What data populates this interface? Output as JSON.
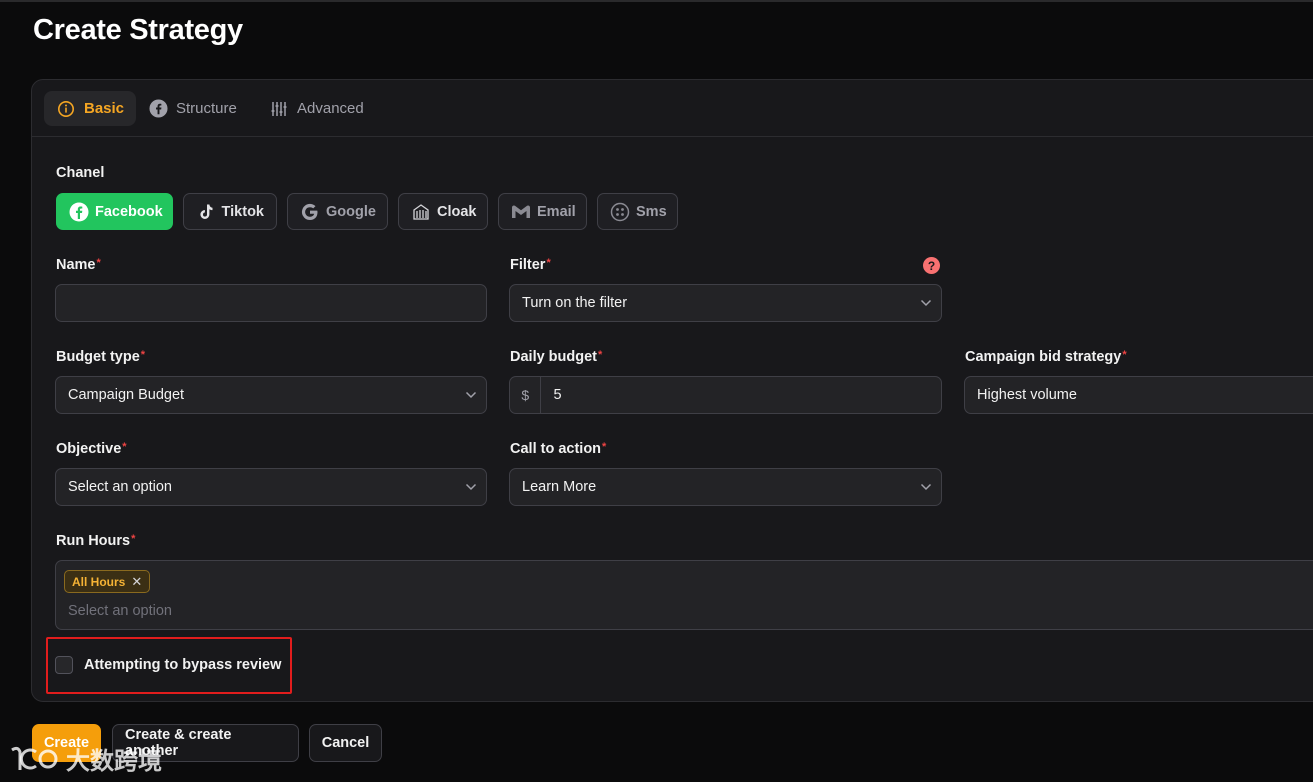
{
  "page": {
    "title": "Create Strategy"
  },
  "tabs": [
    {
      "label": "Basic",
      "icon": "info-icon",
      "active": true
    },
    {
      "label": "Structure",
      "icon": "facebook-icon",
      "active": false
    },
    {
      "label": "Advanced",
      "icon": "sliders-icon",
      "active": false
    }
  ],
  "channel": {
    "label": "Chanel",
    "options": [
      {
        "label": "Facebook",
        "icon": "facebook-icon",
        "selected": true
      },
      {
        "label": "Tiktok",
        "icon": "tiktok-icon",
        "selected": false
      },
      {
        "label": "Google",
        "icon": "google-icon",
        "selected": false
      },
      {
        "label": "Cloak",
        "icon": "cloak-icon",
        "selected": false
      },
      {
        "label": "Email",
        "icon": "gmail-icon",
        "selected": false
      },
      {
        "label": "Sms",
        "icon": "sms-icon",
        "selected": false
      }
    ]
  },
  "form": {
    "name": {
      "label": "Name",
      "value": ""
    },
    "filter": {
      "label": "Filter",
      "value": "Turn on the filter"
    },
    "budget_type": {
      "label": "Budget type",
      "value": "Campaign Budget"
    },
    "daily_budget": {
      "label": "Daily budget",
      "prefix": "$",
      "value": "5"
    },
    "bid_strategy": {
      "label": "Campaign bid strategy",
      "value": "Highest volume"
    },
    "objective": {
      "label": "Objective",
      "value": "Select an option"
    },
    "call_to_action": {
      "label": "Call to action",
      "value": "Learn More"
    },
    "run_hours": {
      "label": "Run Hours",
      "chips": [
        "All Hours"
      ],
      "placeholder": "Select an option"
    },
    "bypass": {
      "label": "Attempting to bypass review",
      "checked": false
    }
  },
  "actions": {
    "create": "Create",
    "create_another": "Create & create another",
    "cancel": "Cancel"
  },
  "watermark": {
    "text": "大数跨境"
  },
  "colors": {
    "accent": "#f59e0b",
    "channel_active": "#22c55e",
    "required": "#ef4444",
    "highlight_box": "#e11d1d"
  }
}
